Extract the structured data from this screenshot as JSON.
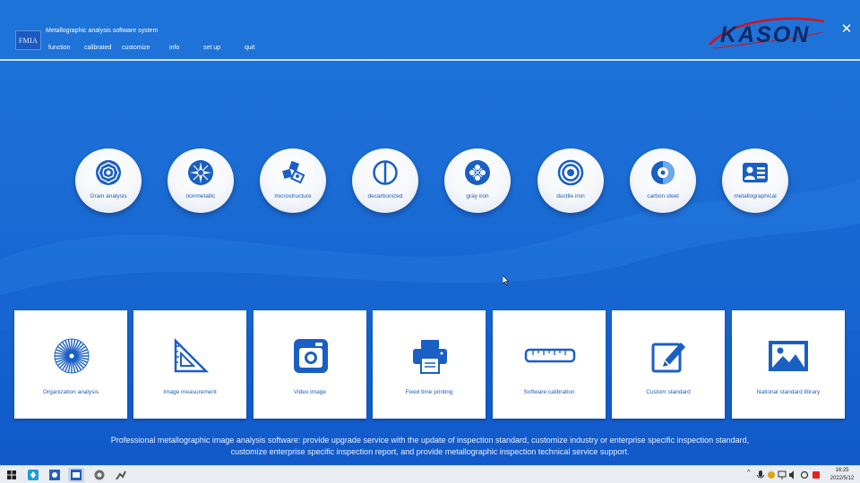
{
  "app": {
    "logo_text": "FMIA",
    "title": "Metallographic analysis software system",
    "brand": "KASON"
  },
  "menu": [
    {
      "label": "function"
    },
    {
      "label": "calibrated"
    },
    {
      "label": "customize"
    },
    {
      "label": "info"
    },
    {
      "label": "set up"
    },
    {
      "label": "quit"
    }
  ],
  "window_controls": {
    "close_glyph": "✕"
  },
  "analysis_buttons": [
    {
      "label": "Grain analysis",
      "icon": "grain-icon"
    },
    {
      "label": "nonmetallic",
      "icon": "nonmetallic-icon"
    },
    {
      "label": "microstructure",
      "icon": "microstructure-icon"
    },
    {
      "label": "decarbonized",
      "icon": "decarbonized-icon"
    },
    {
      "label": "gray iron",
      "icon": "gray-iron-icon"
    },
    {
      "label": "ductile iron",
      "icon": "ductile-iron-icon"
    },
    {
      "label": "carbon steel",
      "icon": "carbon-steel-icon"
    },
    {
      "label": "metallographical",
      "icon": "metallographical-icon"
    }
  ],
  "tool_cards": [
    {
      "label": "Organization analysis",
      "icon": "starburst-icon"
    },
    {
      "label": "Image measurement",
      "icon": "set-square-icon"
    },
    {
      "label": "Video image",
      "icon": "camera-icon"
    },
    {
      "label": "Fixed time printing",
      "icon": "printer-icon"
    },
    {
      "label": "Software calibration",
      "icon": "ruler-icon"
    },
    {
      "label": "Custom standard",
      "icon": "edit-icon"
    },
    {
      "label": "National standard library",
      "icon": "picture-icon"
    }
  ],
  "footer": {
    "line1": "Professional metallographic image analysis software: provide upgrade service with the update of inspection standard, customize industry or enterprise specific inspection standard,",
    "line2": "customize enterprise specific inspection report, and provide metallographic inspection technical service support."
  },
  "taskbar": {
    "time": "16:25",
    "date": "2022/5/12"
  },
  "colors": {
    "background": "#1a6ad4",
    "icon_blue": "#1a5fc4",
    "label_blue": "#1c5bb8",
    "brand_red": "#d0141c"
  }
}
